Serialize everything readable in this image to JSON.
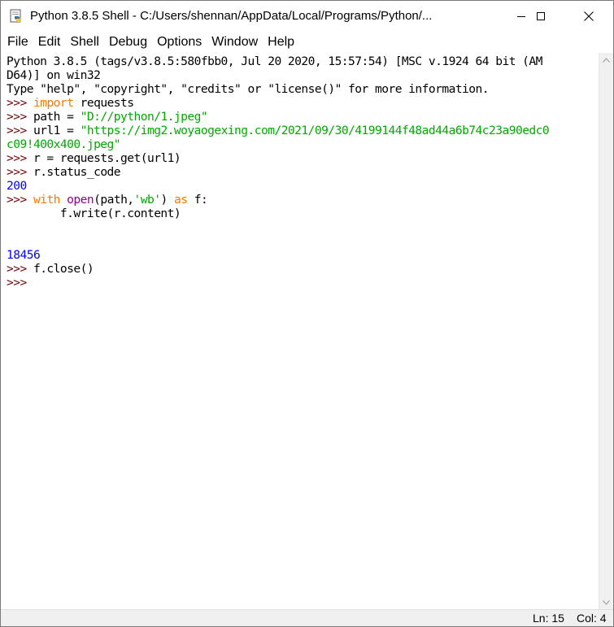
{
  "window": {
    "title": "Python 3.8.5 Shell - C:/Users/shennan/AppData/Local/Programs/Python/..."
  },
  "menu": {
    "items": [
      {
        "label": "File"
      },
      {
        "label": "Edit"
      },
      {
        "label": "Shell"
      },
      {
        "label": "Debug"
      },
      {
        "label": "Options"
      },
      {
        "label": "Window"
      },
      {
        "label": "Help"
      }
    ]
  },
  "shell": {
    "prompt": ">>>",
    "banner1": "Python 3.8.5 (tags/v3.8.5:580fbb0, Jul 20 2020, 15:57:54) [MSC v.1924 64 bit (AM",
    "banner2": "D64)] on win32",
    "banner3": "Type \"help\", \"copyright\", \"credits\" or \"license()\" for more information.",
    "l4_kw": "import",
    "l4_rest": " requests",
    "l5_code": " path = ",
    "l5_str": "\"D://python/1.jpeg\"",
    "l6_code": " url1 = ",
    "l6_str": "\"https://img2.woyaogexing.com/2021/09/30/4199144f48ad44a6b74c23a90edc0",
    "l7_str": "c09!400x400.jpeg\"",
    "l8_code": " r = requests.get(url1)",
    "l9_code": " r.status_code",
    "out_200": "200",
    "l11_kw1": "with",
    "l11_bi": "open",
    "l11_mid": "(path,",
    "l11_str": "'wb'",
    "l11_close": ") ",
    "l11_kw2": "as",
    "l11_end": " f:",
    "l12_code": "        f.write(r.content)",
    "out_18456": "18456",
    "l14_code": " f.close()"
  },
  "status": {
    "ln": "Ln: 15",
    "col": "Col: 4"
  },
  "colors": {
    "prompt": "#770000",
    "keyword": "#ff7700",
    "string": "#00aa00",
    "builtin": "#900090",
    "output": "#0000ff"
  }
}
